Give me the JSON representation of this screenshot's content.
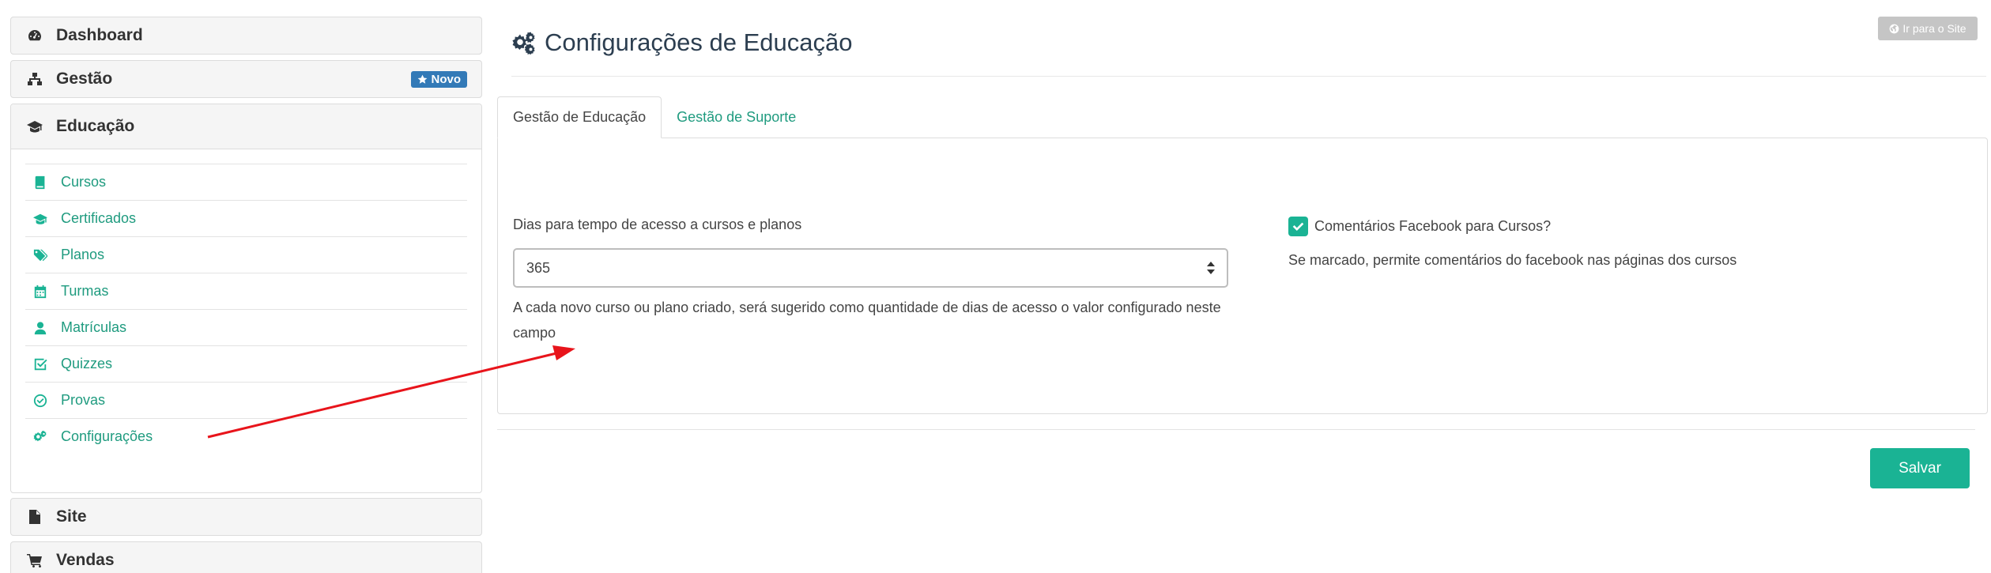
{
  "sidebar": {
    "dashboard": "Dashboard",
    "gestao": "Gestão",
    "gestao_badge": "Novo",
    "educacao": "Educação",
    "educacao_items": [
      {
        "label": "Cursos",
        "icon": "book-icon"
      },
      {
        "label": "Certificados",
        "icon": "graduation-cap-icon"
      },
      {
        "label": "Planos",
        "icon": "tags-icon"
      },
      {
        "label": "Turmas",
        "icon": "calendar-icon"
      },
      {
        "label": "Matrículas",
        "icon": "user-icon"
      },
      {
        "label": "Quizzes",
        "icon": "check-square-icon"
      },
      {
        "label": "Provas",
        "icon": "check-circle-icon"
      },
      {
        "label": "Configurações",
        "icon": "gears-icon"
      }
    ],
    "site": "Site",
    "vendas": "Vendas"
  },
  "header": {
    "site_button": "Ir para o Site",
    "title": "Configurações de Educação"
  },
  "tabs": [
    "Gestão de Educação",
    "Gestão de Suporte"
  ],
  "form": {
    "days_label": "Dias para tempo de acesso a cursos e planos",
    "days_value": "365",
    "days_help": "A cada novo curso ou plano criado, será sugerido como quantidade de dias de acesso o valor configurado neste campo",
    "facebook_label": "Comentários Facebook para Cursos?",
    "facebook_checked": true,
    "facebook_help": "Se marcado, permite comentários do facebook nas páginas dos cursos"
  },
  "save_button": "Salvar",
  "colors": {
    "accent": "#1ab394",
    "link": "#1f9b7f",
    "badge": "#337ab7",
    "annotation_arrow": "#e8141b"
  }
}
